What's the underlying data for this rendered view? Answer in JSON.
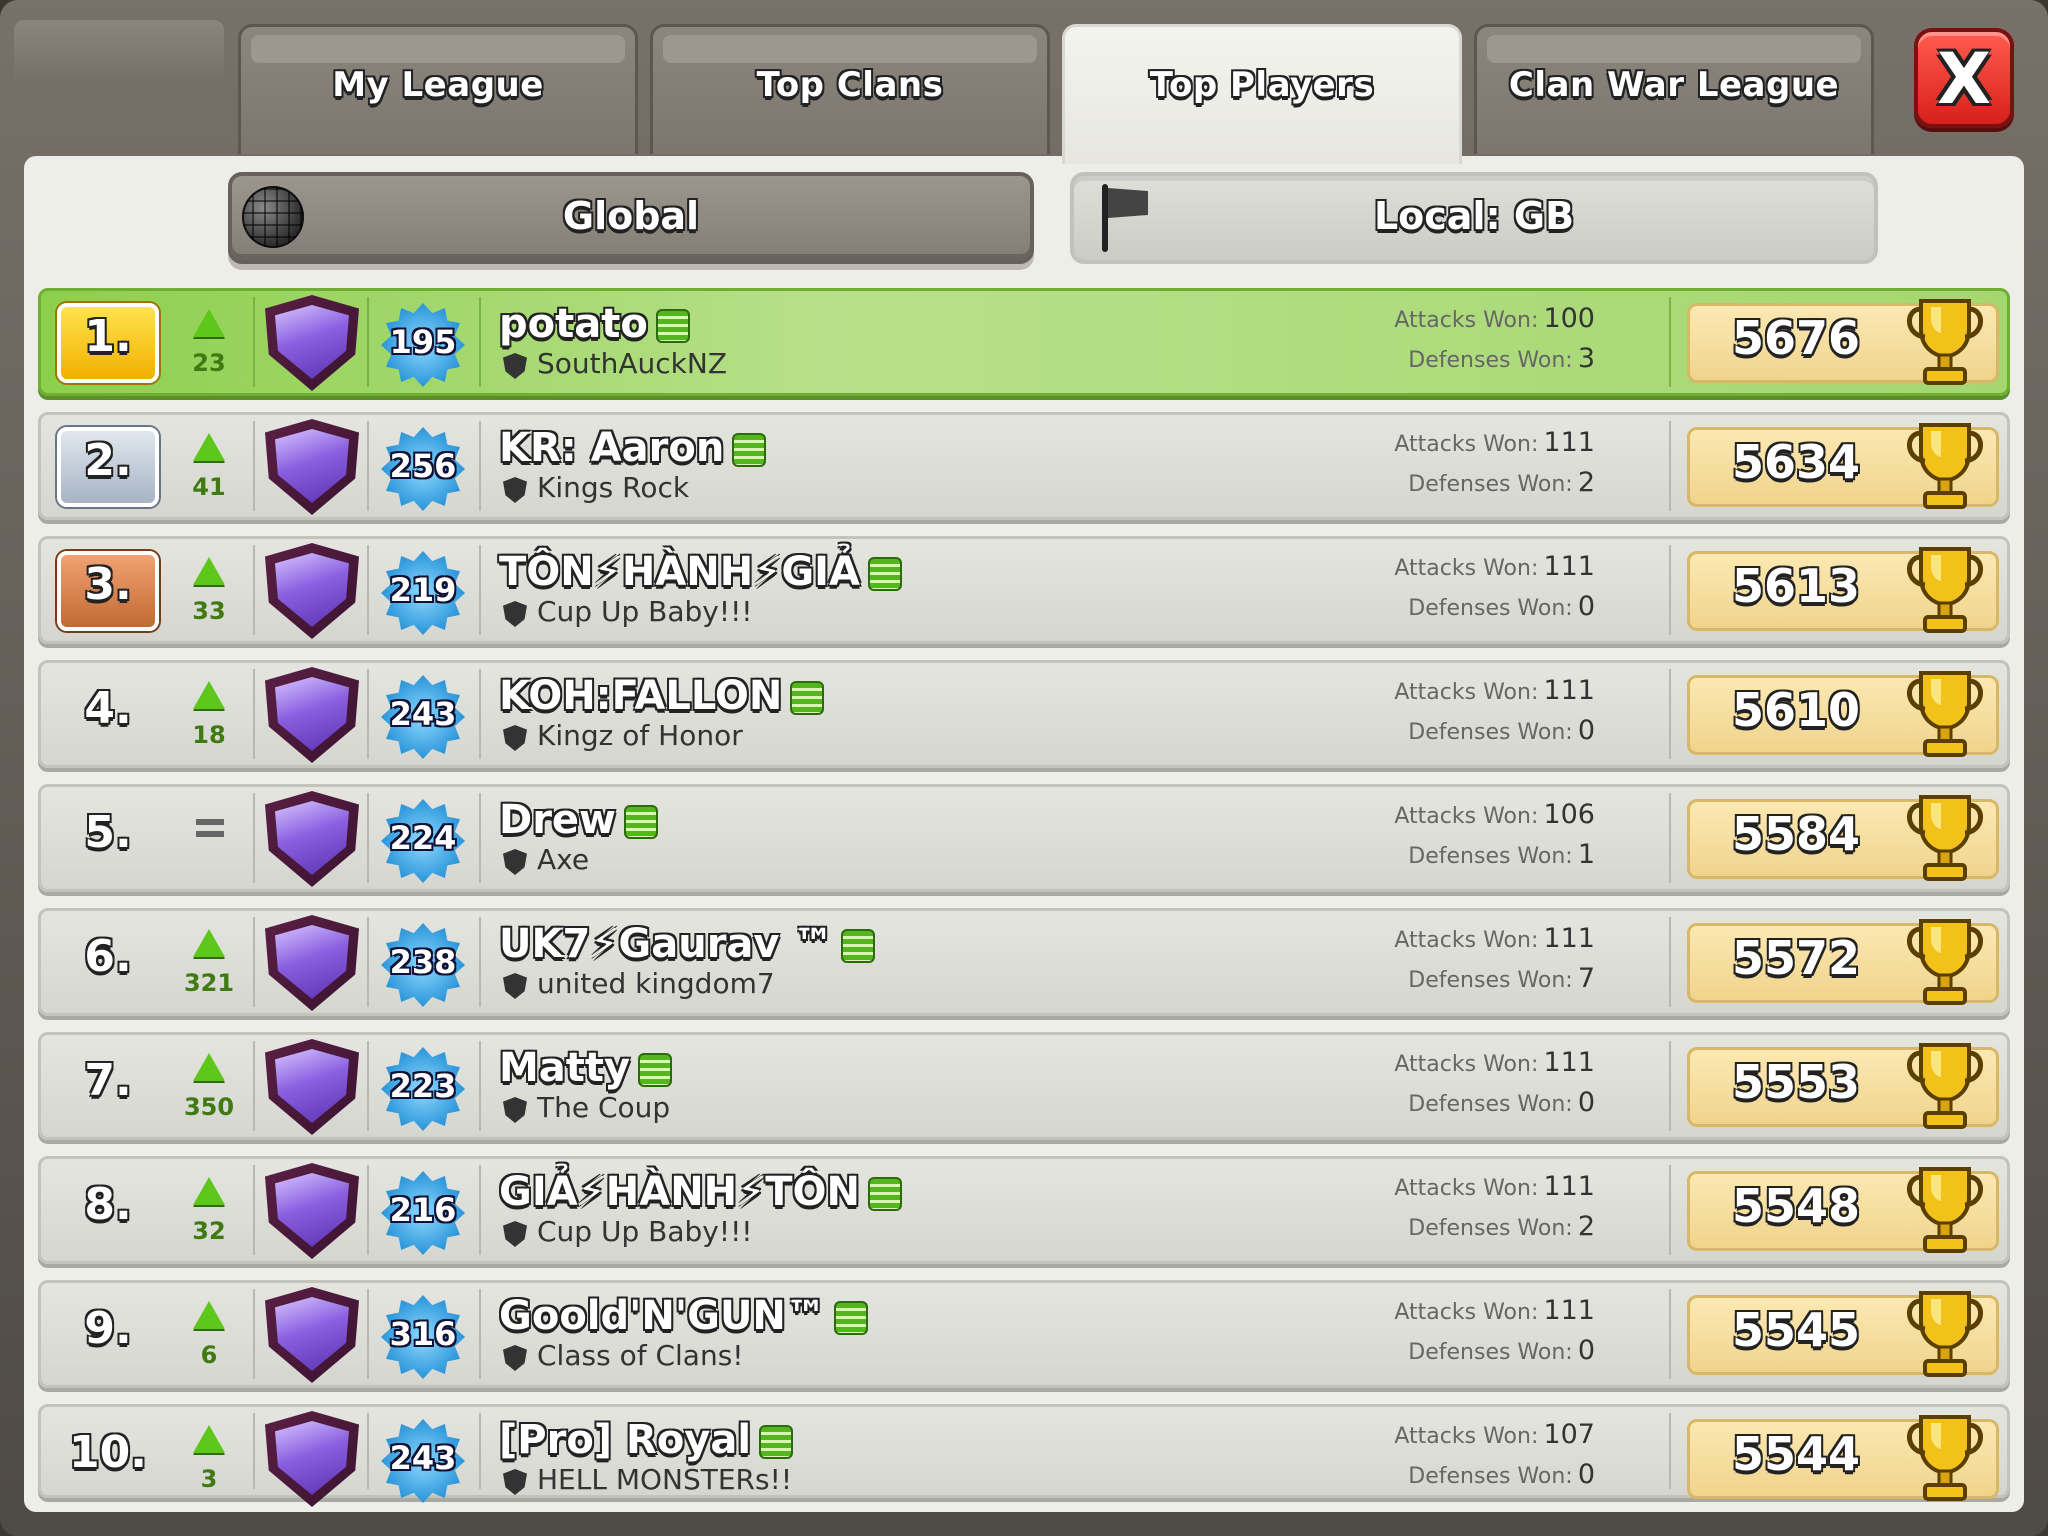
{
  "tabs": [
    {
      "label": "My League",
      "active": false
    },
    {
      "label": "Top Clans",
      "active": false
    },
    {
      "label": "Top Players",
      "active": true
    },
    {
      "label": "Clan War League",
      "active": false
    }
  ],
  "close_button": {
    "label": "X",
    "icon": "close-icon"
  },
  "filters": {
    "global": {
      "label": "Global",
      "icon": "globe-icon",
      "selected": true
    },
    "local": {
      "label": "Local: GB",
      "icon": "flag-icon",
      "selected": false
    }
  },
  "stat_labels": {
    "attacks": "Attacks Won:",
    "defenses": "Defenses Won:"
  },
  "players": [
    {
      "rank": "1.",
      "trend": "up",
      "change": "23",
      "xp": "195",
      "name": "potato",
      "clan": "SouthAuckNZ",
      "attacks": "100",
      "defenses": "3",
      "trophies": "5676"
    },
    {
      "rank": "2.",
      "trend": "up",
      "change": "41",
      "xp": "256",
      "name": "KR: Aaron",
      "clan": "Kings Rock",
      "attacks": "111",
      "defenses": "2",
      "trophies": "5634"
    },
    {
      "rank": "3.",
      "trend": "up",
      "change": "33",
      "xp": "219",
      "name": "TÔN⚡HÀNH⚡GIẢ",
      "clan": "Cup Up Baby!!!",
      "attacks": "111",
      "defenses": "0",
      "trophies": "5613"
    },
    {
      "rank": "4.",
      "trend": "up",
      "change": "18",
      "xp": "243",
      "name": "KOH:FALLON",
      "clan": "Kingz of Honor",
      "attacks": "111",
      "defenses": "0",
      "trophies": "5610"
    },
    {
      "rank": "5.",
      "trend": "same",
      "change": "",
      "xp": "224",
      "name": "Drew",
      "clan": "Axe",
      "attacks": "106",
      "defenses": "1",
      "trophies": "5584"
    },
    {
      "rank": "6.",
      "trend": "up",
      "change": "321",
      "xp": "238",
      "name": "UK7⚡Gaurav ™",
      "clan": "united kingdom7",
      "attacks": "111",
      "defenses": "7",
      "trophies": "5572"
    },
    {
      "rank": "7.",
      "trend": "up",
      "change": "350",
      "xp": "223",
      "name": "Matty",
      "clan": "The Coup",
      "attacks": "111",
      "defenses": "0",
      "trophies": "5553"
    },
    {
      "rank": "8.",
      "trend": "up",
      "change": "32",
      "xp": "216",
      "name": "GIẢ⚡HÀNH⚡TÔN",
      "clan": "Cup Up Baby!!!",
      "attacks": "111",
      "defenses": "2",
      "trophies": "5548"
    },
    {
      "rank": "9.",
      "trend": "up",
      "change": "6",
      "xp": "316",
      "name": "Goold'N'GUN™",
      "clan": "Class of Clans!",
      "attacks": "111",
      "defenses": "0",
      "trophies": "5545"
    },
    {
      "rank": "10.",
      "trend": "up",
      "change": "3",
      "xp": "243",
      "name": "[Pro] Royal",
      "clan": "HELL MONSTERs!!",
      "attacks": "107",
      "defenses": "0",
      "trophies": "5544"
    }
  ],
  "colors": {
    "first_row": "#a5d770",
    "gold": "#f1b000",
    "silver": "#a6b4c4",
    "bronze": "#c26a35",
    "trend_up": "#5ec71b",
    "trophy_box": "#f0d48d",
    "close_button": "#d9201b"
  }
}
